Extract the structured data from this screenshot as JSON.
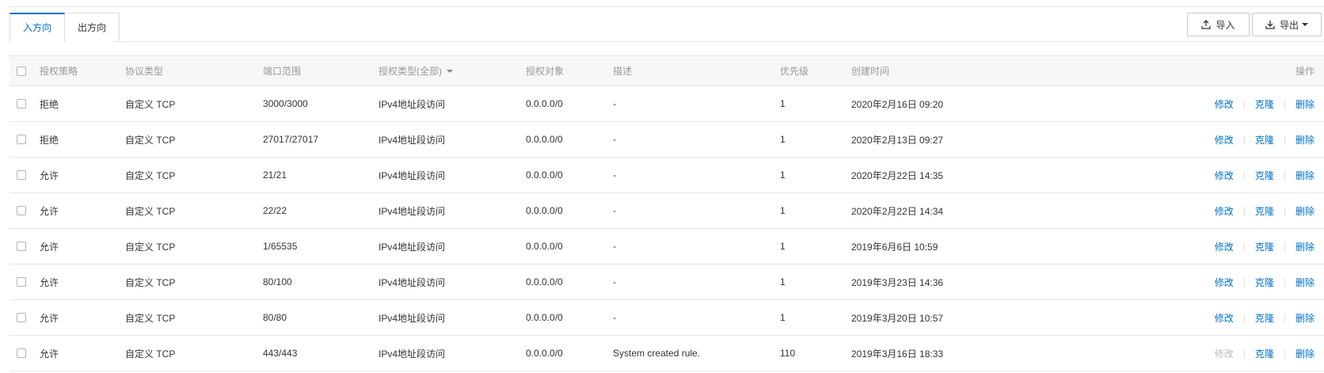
{
  "tabs": [
    {
      "label": "入方向"
    },
    {
      "label": "出方向"
    }
  ],
  "toolbar": {
    "import_label": "导入",
    "export_label": "导出"
  },
  "table": {
    "headers": {
      "policy": "授权策略",
      "protocol": "协议类型",
      "port": "端口范围",
      "auth_type": "授权类型(全部)",
      "object": "授权对象",
      "description": "描述",
      "priority": "优先级",
      "created": "创建时间",
      "ops": "操作"
    },
    "op_labels": {
      "edit": "修改",
      "clone": "克隆",
      "delete": "删除",
      "separator": "|"
    },
    "rows": [
      {
        "policy": "拒绝",
        "protocol": "自定义 TCP",
        "port": "3000/3000",
        "auth_type": "IPv4地址段访问",
        "object": "0.0.0.0/0",
        "description": "-",
        "priority": "1",
        "created": "2020年2月16日 09:20",
        "edit_enabled": true
      },
      {
        "policy": "拒绝",
        "protocol": "自定义 TCP",
        "port": "27017/27017",
        "auth_type": "IPv4地址段访问",
        "object": "0.0.0.0/0",
        "description": "-",
        "priority": "1",
        "created": "2020年2月13日 09:27",
        "edit_enabled": true
      },
      {
        "policy": "允许",
        "protocol": "自定义 TCP",
        "port": "21/21",
        "auth_type": "IPv4地址段访问",
        "object": "0.0.0.0/0",
        "description": "-",
        "priority": "1",
        "created": "2020年2月22日 14:35",
        "edit_enabled": true
      },
      {
        "policy": "允许",
        "protocol": "自定义 TCP",
        "port": "22/22",
        "auth_type": "IPv4地址段访问",
        "object": "0.0.0.0/0",
        "description": "-",
        "priority": "1",
        "created": "2020年2月22日 14:34",
        "edit_enabled": true
      },
      {
        "policy": "允许",
        "protocol": "自定义 TCP",
        "port": "1/65535",
        "auth_type": "IPv4地址段访问",
        "object": "0.0.0.0/0",
        "description": "-",
        "priority": "1",
        "created": "2019年6月6日 10:59",
        "edit_enabled": true
      },
      {
        "policy": "允许",
        "protocol": "自定义 TCP",
        "port": "80/100",
        "auth_type": "IPv4地址段访问",
        "object": "0.0.0.0/0",
        "description": "-",
        "priority": "1",
        "created": "2019年3月23日 14:36",
        "edit_enabled": true
      },
      {
        "policy": "允许",
        "protocol": "自定义 TCP",
        "port": "80/80",
        "auth_type": "IPv4地址段访问",
        "object": "0.0.0.0/0",
        "description": "-",
        "priority": "1",
        "created": "2019年3月20日 10:57",
        "edit_enabled": true
      },
      {
        "policy": "允许",
        "protocol": "自定义 TCP",
        "port": "443/443",
        "auth_type": "IPv4地址段访问",
        "object": "0.0.0.0/0",
        "description": "System created rule.",
        "priority": "110",
        "created": "2019年3月16日 18:33",
        "edit_enabled": false
      }
    ]
  },
  "colors": {
    "accent": "#0070cc",
    "disabled": "#bbbbbb"
  }
}
